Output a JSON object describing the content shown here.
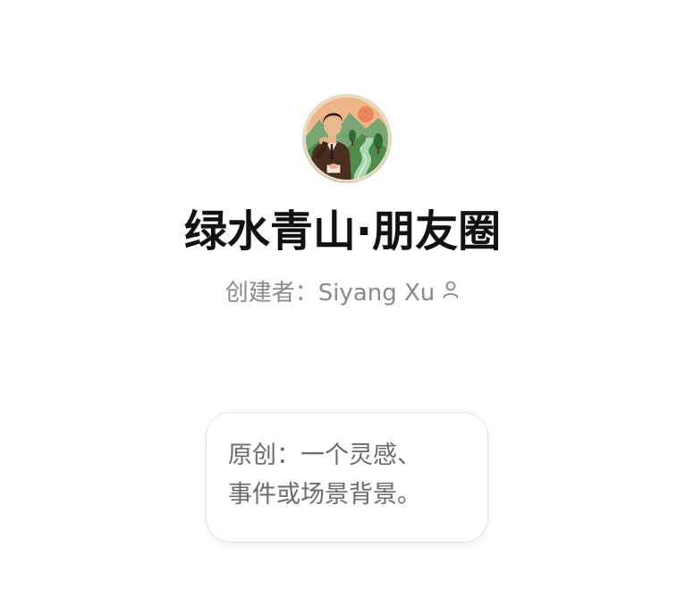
{
  "profile": {
    "avatar_alt": "avatar",
    "title": "绿水青山·朋友圈",
    "creator_label": "创建者：",
    "creator_name": "Siyang Xu",
    "creator_icon": "person-icon"
  },
  "prompt_card": {
    "line1": "原创：一个灵感、",
    "line2": "事件或场景背景。"
  },
  "colors": {
    "title": "#111111",
    "muted": "#8a8a8a",
    "card_text": "#6b6b6b",
    "card_border": "#e2e2e2",
    "avatar_green": "#5e9a5a",
    "avatar_orange": "#e9a06a"
  }
}
